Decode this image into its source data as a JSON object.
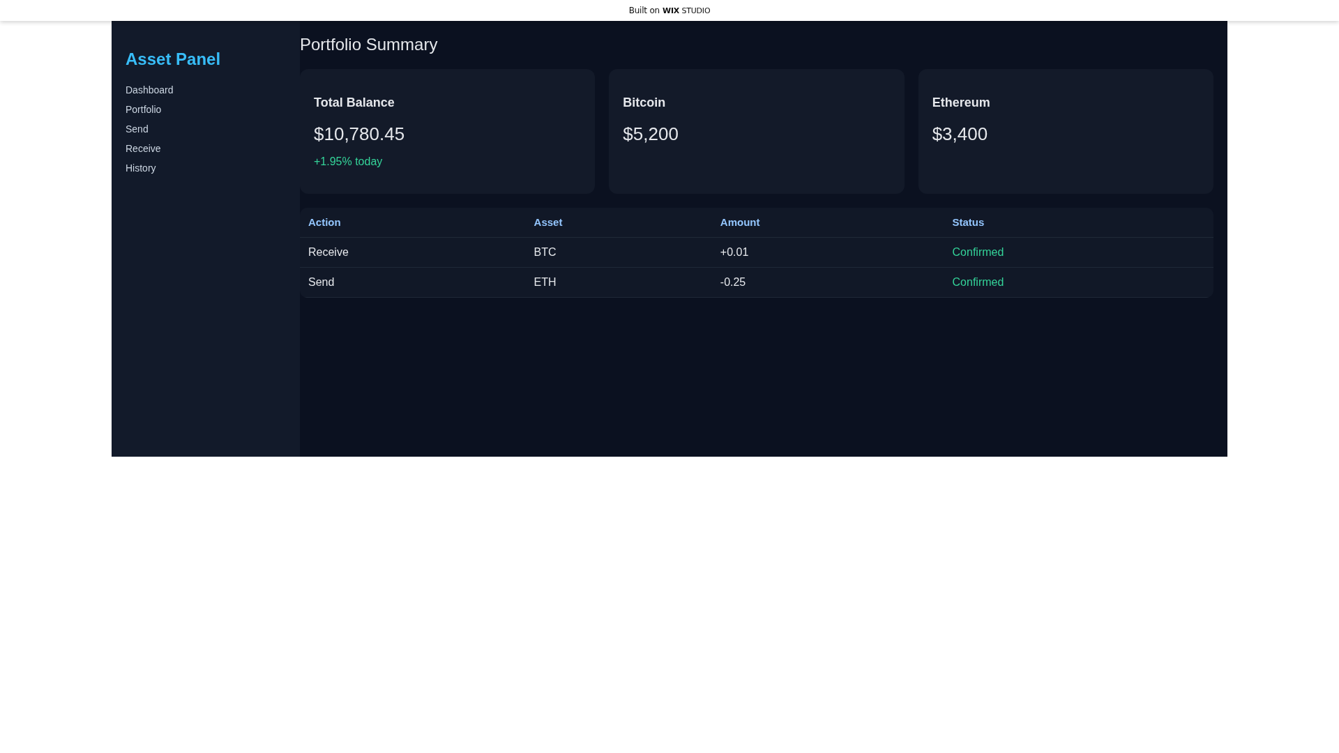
{
  "banner": {
    "prefix": "Built on",
    "brand": "WIX",
    "product": "STUDIO"
  },
  "sidebar": {
    "title": "Asset Panel",
    "items": [
      "Dashboard",
      "Portfolio",
      "Send",
      "Receive",
      "History"
    ]
  },
  "main": {
    "title": "Portfolio Summary",
    "cards": [
      {
        "title": "Total Balance",
        "value": "$10,780.45",
        "change": "+1.95% today"
      },
      {
        "title": "Bitcoin",
        "value": "$5,200"
      },
      {
        "title": "Ethereum",
        "value": "$3,400"
      }
    ],
    "table": {
      "columns": [
        "Action",
        "Asset",
        "Amount",
        "Status"
      ],
      "rows": [
        {
          "action": "Receive",
          "asset": "BTC",
          "amount": "+0.01",
          "status": "Confirmed"
        },
        {
          "action": "Send",
          "asset": "ETH",
          "amount": "-0.25",
          "status": "Confirmed"
        }
      ]
    }
  }
}
